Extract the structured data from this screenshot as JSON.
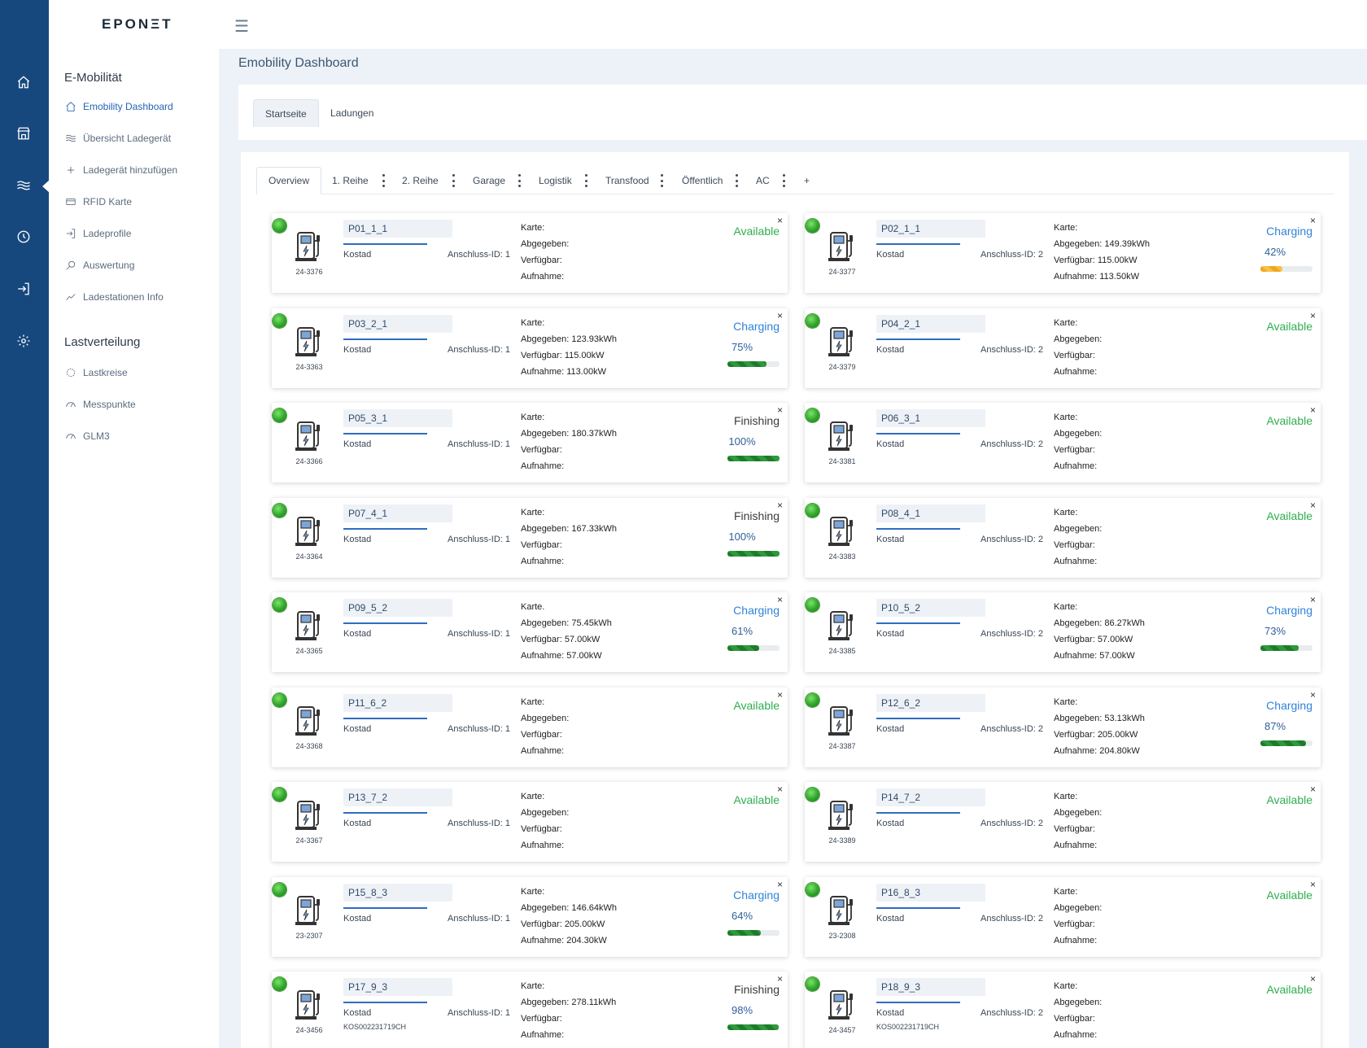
{
  "brand": {
    "logo": "EPONΞT"
  },
  "rail": {
    "icons": [
      "home-icon",
      "store-icon",
      "waves-icon",
      "clock-icon",
      "login-icon",
      "settings-icon"
    ]
  },
  "sidebar": {
    "section1": "E-Mobilität",
    "items1": [
      {
        "label": "Emobility Dashboard",
        "icon": "home-icon"
      },
      {
        "label": "Übersicht Ladegerät",
        "icon": "waves-icon"
      },
      {
        "label": "Ladegerät hinzufügen",
        "icon": "plus-icon"
      },
      {
        "label": "RFID Karte",
        "icon": "card-icon"
      },
      {
        "label": "Ladeprofile",
        "icon": "login-icon"
      },
      {
        "label": "Auswertung",
        "icon": "search-icon"
      },
      {
        "label": "Ladestationen Info",
        "icon": "trend-icon"
      }
    ],
    "section2": "Lastverteilung",
    "items2": [
      {
        "label": "Lastkreise",
        "icon": "circle-icon"
      },
      {
        "label": "Messpunkte",
        "icon": "gauge-icon"
      },
      {
        "label": "GLM3",
        "icon": "gauge-icon"
      }
    ]
  },
  "header": {
    "page_title": "Emobility Dashboard"
  },
  "top_tabs": [
    "Startseite",
    "Ladungen"
  ],
  "sub_tabs": [
    "Overview",
    "1. Reihe",
    "2. Reihe",
    "Garage",
    "Logistik",
    "Transfood",
    "Öffentlich",
    "AC",
    "+"
  ],
  "labels": {
    "karte": "Karte:",
    "abgegeben": "Abgegeben:",
    "verfuegbar": "Verfügbar:",
    "aufnahme": "Aufnahme:",
    "close": "×"
  },
  "colors": {
    "rail": "#16487e",
    "available": "#2fae4f",
    "charging": "#2f83d8",
    "progress": "#1f7a2b",
    "progress_low": "#f0a81e",
    "led": "#2fa52a"
  },
  "chargers": [
    {
      "name": "P01_1_1",
      "station": "24-3376",
      "owner": "Kostad",
      "serial": "",
      "conn": "Anschluss-ID: 1",
      "karte": "Karte:",
      "abgegeben": "Abgegeben:",
      "verfuegbar": "Verfügbar:",
      "aufnahme": "Aufnahme:",
      "status": "Available",
      "percent": "",
      "progress": null
    },
    {
      "name": "P02_1_1",
      "station": "24-3377",
      "owner": "Kostad",
      "serial": "",
      "conn": "Anschluss-ID: 2",
      "karte": "Karte:",
      "abgegeben": "Abgegeben: 149.39kWh",
      "verfuegbar": "Verfügbar: 115.00kW",
      "aufnahme": "Aufnahme: 113.50kW",
      "status": "Charging",
      "percent": "42%",
      "progress": 0.42
    },
    {
      "name": "P03_2_1",
      "station": "24-3363",
      "owner": "Kostad",
      "serial": "",
      "conn": "Anschluss-ID: 1",
      "karte": "Karte:",
      "abgegeben": "Abgegeben: 123.93kWh",
      "verfuegbar": "Verfügbar: 115.00kW",
      "aufnahme": "Aufnahme: 113.00kW",
      "status": "Charging",
      "percent": "75%",
      "progress": 0.75
    },
    {
      "name": "P04_2_1",
      "station": "24-3379",
      "owner": "Kostad",
      "serial": "",
      "conn": "Anschluss-ID: 2",
      "karte": "Karte:",
      "abgegeben": "Abgegeben:",
      "verfuegbar": "Verfügbar:",
      "aufnahme": "Aufnahme:",
      "status": "Available",
      "percent": "",
      "progress": null
    },
    {
      "name": "P05_3_1",
      "station": "24-3366",
      "owner": "Kostad",
      "serial": "",
      "conn": "Anschluss-ID: 1",
      "karte": "Karte:",
      "abgegeben": "Abgegeben: 180.37kWh",
      "verfuegbar": "Verfügbar:",
      "aufnahme": "Aufnahme:",
      "status": "Finishing",
      "percent": "100%",
      "progress": 1.0
    },
    {
      "name": "P06_3_1",
      "station": "24-3381",
      "owner": "Kostad",
      "serial": "",
      "conn": "Anschluss-ID: 2",
      "karte": "Karte:",
      "abgegeben": "Abgegeben:",
      "verfuegbar": "Verfügbar:",
      "aufnahme": "Aufnahme:",
      "status": "Available",
      "percent": "",
      "progress": null
    },
    {
      "name": "P07_4_1",
      "station": "24-3364",
      "owner": "Kostad",
      "serial": "",
      "conn": "Anschluss-ID: 1",
      "karte": "Karte:",
      "abgegeben": "Abgegeben: 167.33kWh",
      "verfuegbar": "Verfügbar:",
      "aufnahme": "Aufnahme:",
      "status": "Finishing",
      "percent": "100%",
      "progress": 1.0
    },
    {
      "name": "P08_4_1",
      "station": "24-3383",
      "owner": "Kostad",
      "serial": "",
      "conn": "Anschluss-ID: 2",
      "karte": "Karte:",
      "abgegeben": "Abgegeben:",
      "verfuegbar": "Verfügbar:",
      "aufnahme": "Aufnahme:",
      "status": "Available",
      "percent": "",
      "progress": null
    },
    {
      "name": "P09_5_2",
      "station": "24-3365",
      "owner": "Kostad",
      "serial": "",
      "conn": "Anschluss-ID: 1",
      "karte": "Karte.",
      "abgegeben": "Abgegeben: 75.45kWh",
      "verfuegbar": "Verfügbar: 57.00kW",
      "aufnahme": "Aufnahme: 57.00kW",
      "status": "Charging",
      "percent": "61%",
      "progress": 0.61
    },
    {
      "name": "P10_5_2",
      "station": "24-3385",
      "owner": "Kostad",
      "serial": "",
      "conn": "Anschluss-ID: 2",
      "karte": "Karte:",
      "abgegeben": "Abgegeben: 86.27kWh",
      "verfuegbar": "Verfügbar: 57.00kW",
      "aufnahme": "Aufnahme: 57.00kW",
      "status": "Charging",
      "percent": "73%",
      "progress": 0.73
    },
    {
      "name": "P11_6_2",
      "station": "24-3368",
      "owner": "Kostad",
      "serial": "",
      "conn": "Anschluss-ID: 1",
      "karte": "Karte:",
      "abgegeben": "Abgegeben:",
      "verfuegbar": "Verfügbar:",
      "aufnahme": "Aufnahme:",
      "status": "Available",
      "percent": "",
      "progress": null
    },
    {
      "name": "P12_6_2",
      "station": "24-3387",
      "owner": "Kostad",
      "serial": "",
      "conn": "Anschluss-ID: 2",
      "karte": "Karte:",
      "abgegeben": "Abgegeben: 53.13kWh",
      "verfuegbar": "Verfügbar: 205.00kW",
      "aufnahme": "Aufnahme: 204.80kW",
      "status": "Charging",
      "percent": "87%",
      "progress": 0.87
    },
    {
      "name": "P13_7_2",
      "station": "24-3367",
      "owner": "Kostad",
      "serial": "",
      "conn": "Anschluss-ID: 1",
      "karte": "Karte:",
      "abgegeben": "Abgegeben:",
      "verfuegbar": "Verfügbar:",
      "aufnahme": "Aufnahme:",
      "status": "Available",
      "percent": "",
      "progress": null
    },
    {
      "name": "P14_7_2",
      "station": "24-3389",
      "owner": "Kostad",
      "serial": "",
      "conn": "Anschluss-ID: 2",
      "karte": "Karte:",
      "abgegeben": "Abgegeben:",
      "verfuegbar": "Verfügbar:",
      "aufnahme": "Aufnahme:",
      "status": "Available",
      "percent": "",
      "progress": null
    },
    {
      "name": "P15_8_3",
      "station": "23-2307",
      "owner": "Kostad",
      "serial": "",
      "conn": "Anschluss-ID: 1",
      "karte": "Karte:",
      "abgegeben": "Abgegeben: 146.64kWh",
      "verfuegbar": "Verfügbar: 205.00kW",
      "aufnahme": "Aufnahme: 204.30kW",
      "status": "Charging",
      "percent": "64%",
      "progress": 0.64
    },
    {
      "name": "P16_8_3",
      "station": "23-2308",
      "owner": "Kostad",
      "serial": "",
      "conn": "Anschluss-ID: 2",
      "karte": "Karte:",
      "abgegeben": "Abgegeben:",
      "verfuegbar": "Verfügbar:",
      "aufnahme": "Aufnahme:",
      "status": "Available",
      "percent": "",
      "progress": null
    },
    {
      "name": "P17_9_3",
      "station": "24-3456",
      "owner": "Kostad",
      "serial": "KOS002231719CH",
      "conn": "Anschluss-ID: 1",
      "karte": "Karte:",
      "abgegeben": "Abgegeben: 278.11kWh",
      "verfuegbar": "Verfügbar:",
      "aufnahme": "Aufnahme:",
      "status": "Finishing",
      "percent": "98%",
      "progress": 0.98
    },
    {
      "name": "P18_9_3",
      "station": "24-3457",
      "owner": "Kostad",
      "serial": "KOS002231719CH",
      "conn": "Anschluss-ID: 2",
      "karte": "Karte:",
      "abgegeben": "Abgegeben:",
      "verfuegbar": "Verfügbar:",
      "aufnahme": "Aufnahme:",
      "status": "Available",
      "percent": "",
      "progress": null
    }
  ]
}
